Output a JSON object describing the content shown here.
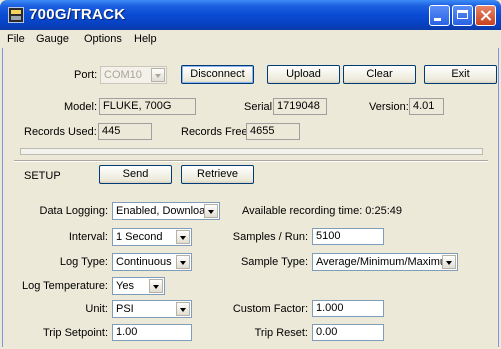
{
  "window": {
    "title": "700G/TRACK"
  },
  "menu": [
    "File",
    "Gauge",
    "Options",
    "Help"
  ],
  "connection": {
    "port_label": "Port:",
    "port_value": "COM10",
    "disconnect": "Disconnect",
    "upload": "Upload",
    "clear": "Clear",
    "exit": "Exit"
  },
  "device": {
    "model_label": "Model:",
    "model_value": "FLUKE, 700G",
    "serial_label": "Serial:",
    "serial_value": "1719048",
    "version_label": "Version:",
    "version_value": "4.01",
    "records_used_label": "Records Used:",
    "records_used_value": "445",
    "records_free_label": "Records Free:",
    "records_free_value": "4655"
  },
  "setup": {
    "label": "SETUP",
    "send": "Send",
    "retrieve": "Retrieve",
    "data_logging_label": "Data Logging:",
    "data_logging_value": "Enabled, Download",
    "available_time": "Available recording time:  0:25:49",
    "interval_label": "Interval:",
    "interval_value": "1 Second",
    "samples_label": "Samples / Run:",
    "samples_value": "5100",
    "log_type_label": "Log Type:",
    "log_type_value": "Continuous",
    "sample_type_label": "Sample Type:",
    "sample_type_value": "Average/Minimum/Maximum",
    "log_temp_label": "Log Temperature:",
    "log_temp_value": "Yes",
    "unit_label": "Unit:",
    "unit_value": "PSI",
    "custom_factor_label": "Custom Factor:",
    "custom_factor_value": "1.000",
    "trip_setpoint_label": "Trip Setpoint:",
    "trip_setpoint_value": "1.00",
    "trip_reset_label": "Trip Reset:",
    "trip_reset_value": "0.00"
  }
}
